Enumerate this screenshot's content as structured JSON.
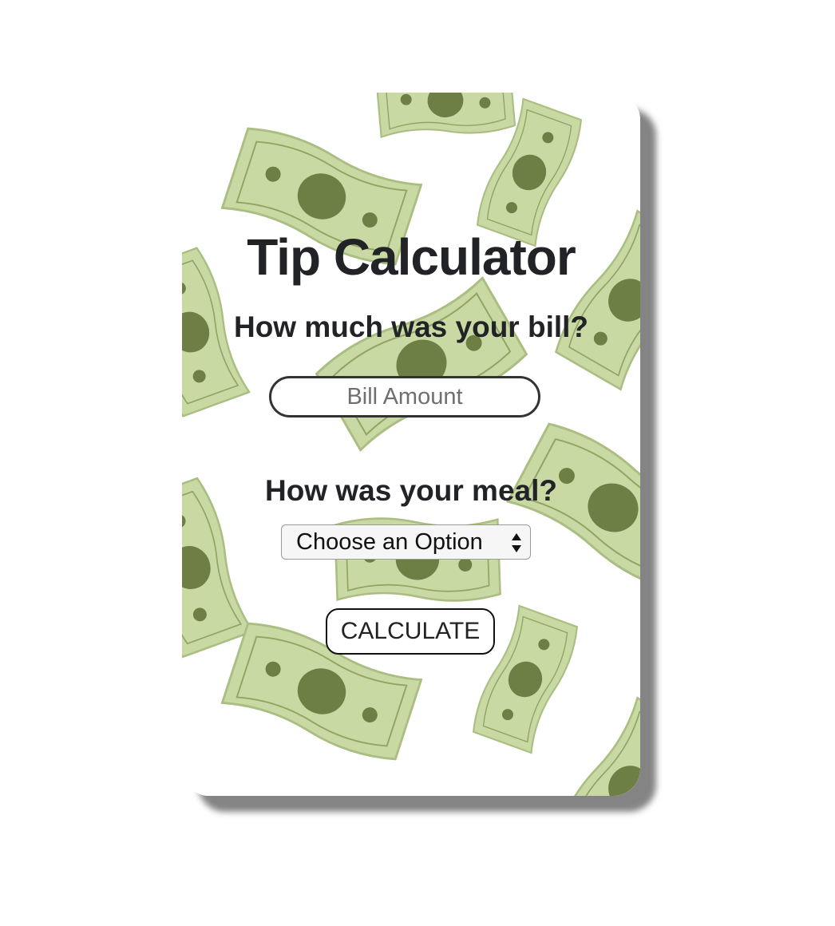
{
  "app": {
    "title": "Tip Calculator"
  },
  "bill": {
    "question": "How much was your bill?",
    "placeholder": "Bill Amount",
    "value": ""
  },
  "meal": {
    "question": "How was your meal?",
    "selected_option": "Choose an Option"
  },
  "actions": {
    "calculate_label": "CALCULATE"
  },
  "colors": {
    "text": "#222326",
    "bill_light": "#c9d9a4",
    "bill_mid": "#a9be80",
    "bill_dark": "#6e7f45",
    "shadow": "#6e6e6e"
  },
  "icons": {
    "background": "money-bills-pattern",
    "select": "select-up-down-arrows-icon"
  }
}
